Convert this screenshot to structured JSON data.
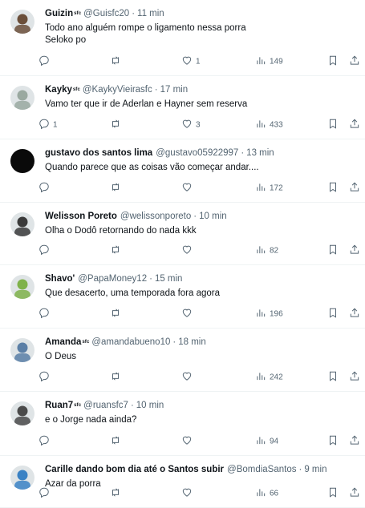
{
  "tweets": [
    {
      "name": "Guizin",
      "badge": "ˢᶠᶜ",
      "handle": "@Guisfc20",
      "time": "11 min",
      "text": "Todo ano alguém rompe o ligamento nessa porra\nSeloko po",
      "replies": "",
      "likes": "1",
      "views": "149",
      "avatar_color": "#6b4f3a"
    },
    {
      "name": "Kayky",
      "badge": "ˢᶠᶜ",
      "handle": "@KaykyVieirasfc",
      "time": "17 min",
      "text": "Vamo ter que ir de Aderlan e Hayner sem reserva",
      "replies": "1",
      "likes": "3",
      "views": "433",
      "avatar_color": "#9aa9a0"
    },
    {
      "name": "gustavo dos santos lima",
      "badge": "",
      "handle": "@gustavo05922997",
      "time": "13 min",
      "text": "Quando parece que as coisas vão começar andar....",
      "replies": "",
      "likes": "",
      "views": "172",
      "avatar_color": "#0a0a0a"
    },
    {
      "name": "Welisson Poreto",
      "badge": "",
      "handle": "@welissonporeto",
      "time": "10 min",
      "text": "Olha o Dodô retornando do nada kkk",
      "replies": "",
      "likes": "",
      "views": "82",
      "avatar_color": "#3a3a3a"
    },
    {
      "name": "Shavo'",
      "badge": "",
      "handle": "@PapaMoney12",
      "time": "15 min",
      "text": "Que desacerto, uma temporada fora agora",
      "replies": "",
      "likes": "",
      "views": "196",
      "avatar_color": "#7fb24a"
    },
    {
      "name": "Amanda",
      "badge": "ˢᶠᶜ",
      "handle": "@amandabueno10",
      "time": "18 min",
      "text": "O Deus",
      "replies": "",
      "likes": "",
      "views": "242",
      "avatar_color": "#5b7fa6"
    },
    {
      "name": "Ruan7",
      "badge": "ˢᶠᶜ",
      "handle": "@ruansfc7",
      "time": "10 min",
      "text": "e o Jorge nada ainda?",
      "replies": "",
      "likes": "",
      "views": "94",
      "avatar_color": "#4a4a4a"
    },
    {
      "name": "Carille dando bom dia até o Santos subir",
      "badge": "",
      "handle": "@BomdiaSantos",
      "time": "9 min",
      "text": "Azar da porra",
      "replies": "",
      "likes": "",
      "views": "66",
      "avatar_color": "#3b82c4"
    }
  ],
  "separator": "·",
  "icons": {
    "reply": "reply-icon",
    "retweet": "retweet-icon",
    "like": "heart-icon",
    "views": "views-chart-icon",
    "bookmark": "bookmark-icon",
    "share": "share-icon"
  }
}
